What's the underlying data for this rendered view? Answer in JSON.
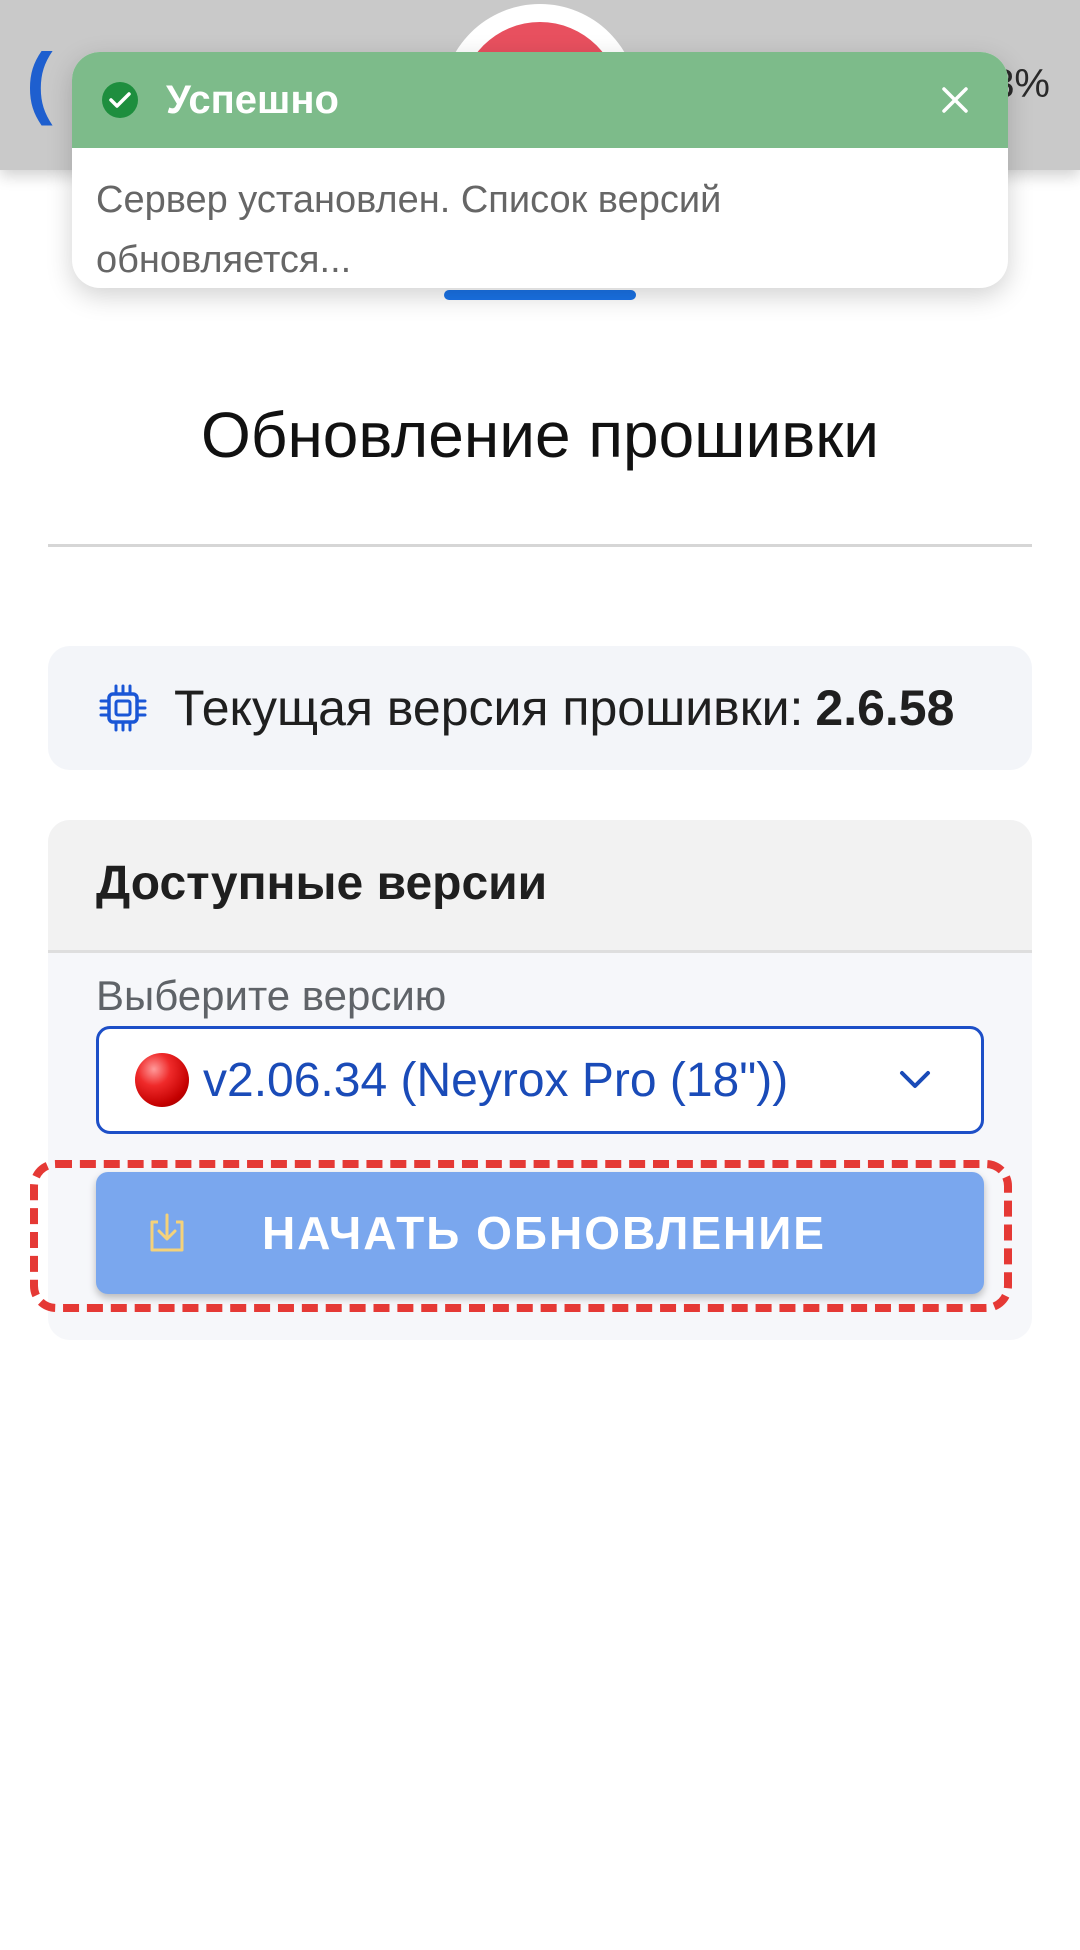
{
  "header": {
    "logo_text": "(",
    "battery_text": "3%"
  },
  "toast": {
    "title": "Успешно",
    "message": "Сервер установлен. Список версий обновляется..."
  },
  "sheet": {
    "title": "Обновление прошивки"
  },
  "current_version": {
    "label": "Текущая версия прошивки:",
    "value": "2.6.58"
  },
  "available_versions": {
    "title": "Доступные версии",
    "select_label": "Выберите версию",
    "selected_value": "v2.06.34 (Neyrox Pro (18\"))"
  },
  "actions": {
    "start_update_label": "НАЧАТЬ ОБНОВЛЕНИЕ"
  },
  "colors": {
    "toast_header": "#7dbb8a",
    "accent_blue": "#1a73e8",
    "button": "#7aa7ee",
    "highlight": "#e53935"
  },
  "icons": {
    "toast_status": "check-circle-icon",
    "toast_close": "close-icon",
    "current_version": "chip-icon",
    "version_status": "red-dot-icon",
    "dropdown": "chevron-down-icon",
    "start_update": "download-icon"
  }
}
